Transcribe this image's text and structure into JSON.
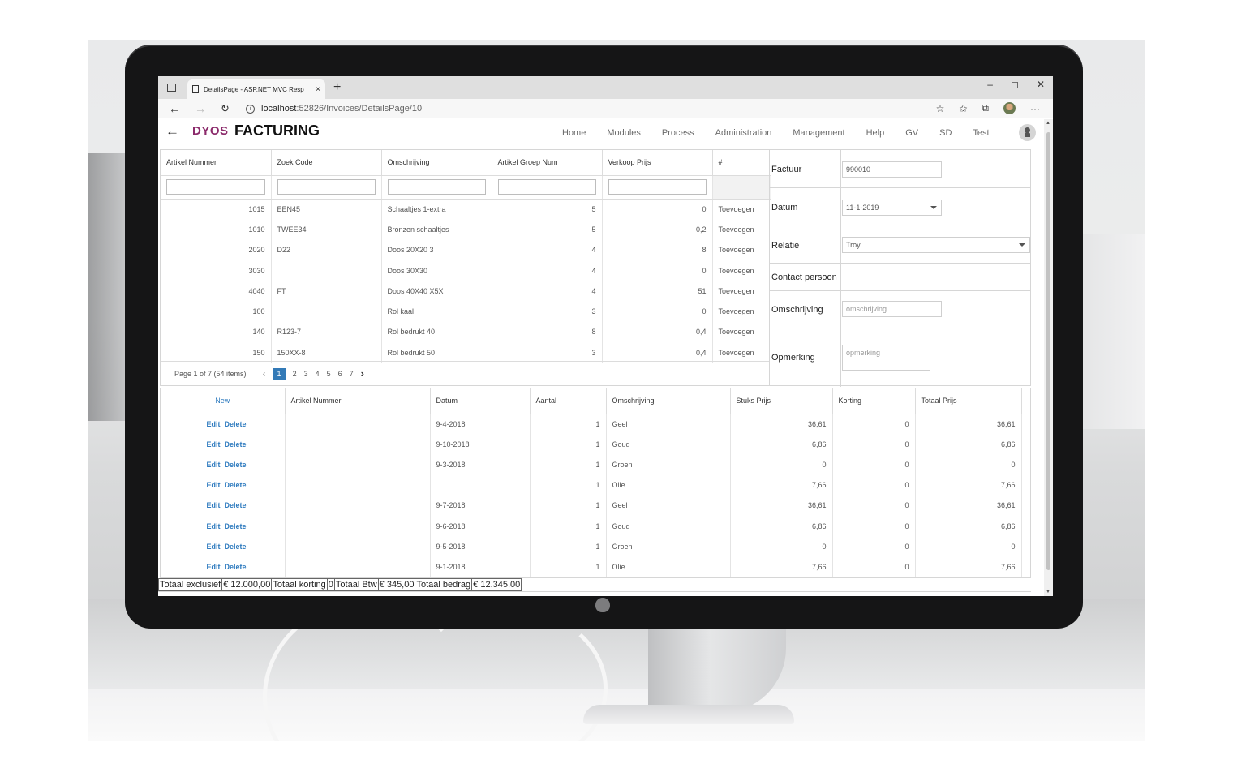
{
  "browser": {
    "tab_title": "DetailsPage - ASP.NET MVC Resp",
    "tab_close": "×",
    "new_tab": "+",
    "url_host": "localhost",
    "url_rest": ":52826/Invoices/DetailsPage/10",
    "win_min": "–",
    "win_max": "◻",
    "win_close": "✕"
  },
  "app": {
    "brand": "DYOS",
    "title": "FACTURING",
    "nav": [
      "Home",
      "Modules",
      "Process",
      "Administration",
      "Management",
      "Help",
      "GV",
      "SD",
      "Test"
    ]
  },
  "articles": {
    "columns": [
      "Artikel Nummer",
      "Zoek Code",
      "Omschrijving",
      "Artikel Groep Num",
      "Verkoop Prijs",
      "#"
    ],
    "action_label": "Toevoegen",
    "rows": [
      {
        "nummer": "1015",
        "zoek": "EEN45",
        "omschrijving": "Schaaltjes 1-extra",
        "groep": "5",
        "prijs": "0"
      },
      {
        "nummer": "1010",
        "zoek": "TWEE34",
        "omschrijving": "Bronzen schaaltjes",
        "groep": "5",
        "prijs": "0,2"
      },
      {
        "nummer": "2020",
        "zoek": "D22",
        "omschrijving": "Doos 20X20 3",
        "groep": "4",
        "prijs": "8"
      },
      {
        "nummer": "3030",
        "zoek": "",
        "omschrijving": "Doos 30X30",
        "groep": "4",
        "prijs": "0"
      },
      {
        "nummer": "4040",
        "zoek": "FT",
        "omschrijving": "Doos 40X40 X5X",
        "groep": "4",
        "prijs": "51"
      },
      {
        "nummer": "100",
        "zoek": "",
        "omschrijving": "Rol kaal",
        "groep": "3",
        "prijs": "0"
      },
      {
        "nummer": "140",
        "zoek": "R123-7",
        "omschrijving": "Rol bedrukt 40",
        "groep": "8",
        "prijs": "0,4"
      },
      {
        "nummer": "150",
        "zoek": "150XX-8",
        "omschrijving": "Rol bedrukt 50",
        "groep": "3",
        "prijs": "0,4"
      }
    ],
    "pager": {
      "summary": "Page 1 of 7 (54 items)",
      "prev": "‹",
      "next": "›",
      "pages": [
        "1",
        "2",
        "3",
        "4",
        "5",
        "6",
        "7"
      ],
      "current": 1
    }
  },
  "invoice": {
    "factuur_label": "Factuur",
    "factuur_value": "990010",
    "datum_label": "Datum",
    "datum_value": "11-1-2019",
    "relatie_label": "Relatie",
    "relatie_value": "Troy",
    "contact_label": "Contact persoon",
    "omschrijving_label": "Omschrijving",
    "omschrijving_placeholder": "omschrijving",
    "opmerking_label": "Opmerking",
    "opmerking_placeholder": "opmerking"
  },
  "lines": {
    "new_label": "New",
    "edit_label": "Edit",
    "delete_label": "Delete",
    "columns": [
      "Artikel Nummer",
      "Datum",
      "Aantal",
      "Omschrijving",
      "Stuks Prijs",
      "Korting",
      "Totaal Prijs"
    ],
    "rows": [
      {
        "artikel": "",
        "datum": "9-4-2018",
        "aantal": "1",
        "omschrijving": "Geel",
        "stuks": "36,61",
        "korting": "0",
        "totaal": "36,61"
      },
      {
        "artikel": "",
        "datum": "9-10-2018",
        "aantal": "1",
        "omschrijving": "Goud",
        "stuks": "6,86",
        "korting": "0",
        "totaal": "6,86"
      },
      {
        "artikel": "",
        "datum": "9-3-2018",
        "aantal": "1",
        "omschrijving": "Groen",
        "stuks": "0",
        "korting": "0",
        "totaal": "0"
      },
      {
        "artikel": "",
        "datum": "",
        "aantal": "1",
        "omschrijving": "Olie",
        "stuks": "7,66",
        "korting": "0",
        "totaal": "7,66"
      },
      {
        "artikel": "",
        "datum": "9-7-2018",
        "aantal": "1",
        "omschrijving": "Geel",
        "stuks": "36,61",
        "korting": "0",
        "totaal": "36,61"
      },
      {
        "artikel": "",
        "datum": "9-6-2018",
        "aantal": "1",
        "omschrijving": "Goud",
        "stuks": "6,86",
        "korting": "0",
        "totaal": "6,86"
      },
      {
        "artikel": "",
        "datum": "9-5-2018",
        "aantal": "1",
        "omschrijving": "Groen",
        "stuks": "0",
        "korting": "0",
        "totaal": "0"
      },
      {
        "artikel": "",
        "datum": "9-1-2018",
        "aantal": "1",
        "omschrijving": "Olie",
        "stuks": "7,66",
        "korting": "0",
        "totaal": "7,66"
      }
    ]
  },
  "totals": {
    "excl_label": "Totaal exclusief",
    "excl_value": "€ 12.000,00",
    "korting_label": "Totaal korting",
    "korting_value": "0",
    "btw_label": "Totaal Btw",
    "btw_value": "€ 345,00",
    "bedrag_label": "Totaal bedrag",
    "bedrag_value": "€ 12.345,00"
  }
}
